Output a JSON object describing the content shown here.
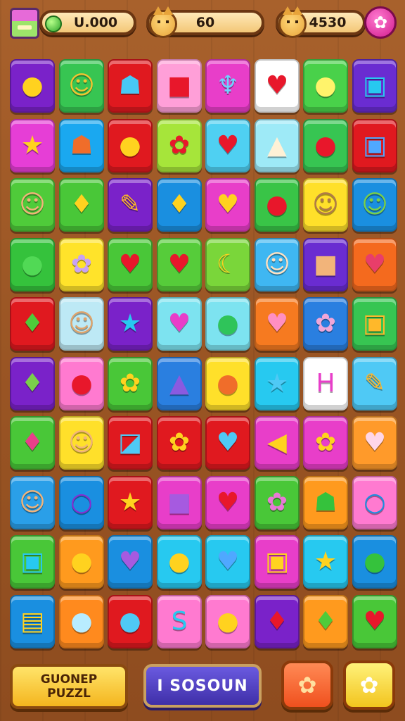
{
  "hud": {
    "coins": "U.000",
    "moves": "60",
    "score": "4530",
    "icons": {
      "shop": "gift-box-icon",
      "coin": "green-gem-icon",
      "moves": "cat-face-icon",
      "score": "cat-face-icon",
      "settings": "flower-icon"
    }
  },
  "board": {
    "rows": 10,
    "cols": 8,
    "tiles": [
      [
        {
          "c": "#7a22c9",
          "g": "●",
          "gc": "#ffd21f"
        },
        {
          "c": "#37c552",
          "g": "☺",
          "gc": "#f4c430"
        },
        {
          "c": "#e0191f",
          "g": "☗",
          "gc": "#47c8f5"
        },
        {
          "c": "#ff9fd8",
          "g": "■",
          "gc": "#e8172b"
        },
        {
          "c": "#e83ec9",
          "g": "♆",
          "gc": "#6fd3ff"
        },
        {
          "c": "#ffffff",
          "g": "♥",
          "gc": "#e8172b"
        },
        {
          "c": "#49d14a",
          "g": "●",
          "gc": "#fff36b"
        },
        {
          "c": "#6a2cd1",
          "g": "▣",
          "gc": "#27c9f0"
        }
      ],
      [
        {
          "c": "#e63ed6",
          "g": "★",
          "gc": "#ffd21f"
        },
        {
          "c": "#1aa8f0",
          "g": "☗",
          "gc": "#f06d2a"
        },
        {
          "c": "#e0191f",
          "g": "●",
          "gc": "#ffd21f"
        },
        {
          "c": "#a6e53a",
          "g": "✿",
          "gc": "#e8172b"
        },
        {
          "c": "#4fd0f2",
          "g": "♥",
          "gc": "#e8172b"
        },
        {
          "c": "#9eeaf7",
          "g": "▲",
          "gc": "#fff1d6"
        },
        {
          "c": "#37c552",
          "g": "●",
          "gc": "#e8172b"
        },
        {
          "c": "#e0191f",
          "g": "▣",
          "gc": "#4fa8ff"
        }
      ],
      [
        {
          "c": "#4fcb3a",
          "g": "☺",
          "gc": "#f2b47a"
        },
        {
          "c": "#49c738",
          "g": "♦",
          "gc": "#ffd21f"
        },
        {
          "c": "#7a22c9",
          "g": "✎",
          "gc": "#ffb82a"
        },
        {
          "c": "#1a8fe0",
          "g": "♦",
          "gc": "#ffd21f"
        },
        {
          "c": "#e83ec9",
          "g": "♥",
          "gc": "#ffd21f"
        },
        {
          "c": "#39c447",
          "g": "●",
          "gc": "#e8172b"
        },
        {
          "c": "#ffe02a",
          "g": "☺",
          "gc": "#b07a4a"
        },
        {
          "c": "#1a8fe0",
          "g": "☺",
          "gc": "#7ad04a"
        }
      ],
      [
        {
          "c": "#35c23c",
          "g": "●",
          "gc": "#51d955"
        },
        {
          "c": "#ffe32a",
          "g": "✿",
          "gc": "#c8a2f5"
        },
        {
          "c": "#49c738",
          "g": "♥",
          "gc": "#e8172b"
        },
        {
          "c": "#56cc3a",
          "g": "♥",
          "gc": "#e8172b"
        },
        {
          "c": "#7ad63a",
          "g": "☾",
          "gc": "#ffd21f"
        },
        {
          "c": "#3fb7f2",
          "g": "☺",
          "gc": "#ffe1c2"
        },
        {
          "c": "#6a2cd1",
          "g": "■",
          "gc": "#f2b47a"
        },
        {
          "c": "#f46a1e",
          "g": "♥",
          "gc": "#e83e6a"
        }
      ],
      [
        {
          "c": "#e0191f",
          "g": "♦",
          "gc": "#4fcb3a"
        },
        {
          "c": "#bde9f5",
          "g": "☺",
          "gc": "#e0a46a"
        },
        {
          "c": "#7a22c9",
          "g": "★",
          "gc": "#27c9f0"
        },
        {
          "c": "#7de3f0",
          "g": "♥",
          "gc": "#e83ec9"
        },
        {
          "c": "#7de3f0",
          "g": "●",
          "gc": "#2fc45a"
        },
        {
          "c": "#f67a20",
          "g": "♥",
          "gc": "#ff8fc2"
        },
        {
          "c": "#2a7fe0",
          "g": "✿",
          "gc": "#f0a6d8"
        },
        {
          "c": "#37c552",
          "g": "▣",
          "gc": "#ffb82a"
        }
      ],
      [
        {
          "c": "#7a22c9",
          "g": "♦",
          "gc": "#7ad04a"
        },
        {
          "c": "#ff7ad0",
          "g": "●",
          "gc": "#e8172b"
        },
        {
          "c": "#49c738",
          "g": "✿",
          "gc": "#ffd21f"
        },
        {
          "c": "#2a7fe0",
          "g": "▲",
          "gc": "#8a5ae0"
        },
        {
          "c": "#ffe02a",
          "g": "●",
          "gc": "#f06d2a"
        },
        {
          "c": "#27c9f0",
          "g": "★",
          "gc": "#4fc9f5"
        },
        {
          "c": "#ffffff",
          "g": "H",
          "gc": "#e83ec9"
        },
        {
          "c": "#4fc9f5",
          "g": "✎",
          "gc": "#ffb82a"
        }
      ],
      [
        {
          "c": "#49c738",
          "g": "♦",
          "gc": "#e83e8a"
        },
        {
          "c": "#ffe02a",
          "g": "☺",
          "gc": "#f2b47a"
        },
        {
          "c": "#e0191f",
          "g": "◪",
          "gc": "#4fc9f5"
        },
        {
          "c": "#e0191f",
          "g": "✿",
          "gc": "#ffd21f"
        },
        {
          "c": "#e0191f",
          "g": "♥",
          "gc": "#4fc9f5"
        },
        {
          "c": "#e83ec9",
          "g": "◀",
          "gc": "#ffd21f"
        },
        {
          "c": "#e83ec9",
          "g": "✿",
          "gc": "#ffd21f"
        },
        {
          "c": "#ff9a2a",
          "g": "♥",
          "gc": "#ffd6e8"
        }
      ],
      [
        {
          "c": "#2a9fe8",
          "g": "☺",
          "gc": "#f2b47a"
        },
        {
          "c": "#1a8fe0",
          "g": "○",
          "gc": "#8a2ad1"
        },
        {
          "c": "#e0191f",
          "g": "★",
          "gc": "#ffd21f"
        },
        {
          "c": "#e83ec9",
          "g": "■",
          "gc": "#a65ae0"
        },
        {
          "c": "#e83ec9",
          "g": "♥",
          "gc": "#e8172b"
        },
        {
          "c": "#49c738",
          "g": "✿",
          "gc": "#e87ad6"
        },
        {
          "c": "#ff9a1e",
          "g": "☗",
          "gc": "#35c23c"
        },
        {
          "c": "#ff7ad0",
          "g": "○",
          "gc": "#1a8fe0"
        }
      ],
      [
        {
          "c": "#49c738",
          "g": "▣",
          "gc": "#27c9f0"
        },
        {
          "c": "#ff9a1e",
          "g": "●",
          "gc": "#ffd21f"
        },
        {
          "c": "#1a8fe0",
          "g": "♥",
          "gc": "#a65ae0"
        },
        {
          "c": "#27c9f0",
          "g": "●",
          "gc": "#ffd21f"
        },
        {
          "c": "#27c9f0",
          "g": "♥",
          "gc": "#4fa8ff"
        },
        {
          "c": "#e83ec9",
          "g": "▣",
          "gc": "#ffd21f"
        },
        {
          "c": "#27c9f0",
          "g": "★",
          "gc": "#ffd21f"
        },
        {
          "c": "#1a8fe0",
          "g": "●",
          "gc": "#35c23c"
        }
      ],
      [
        {
          "c": "#1a8fe0",
          "g": "▤",
          "gc": "#ffd21f"
        },
        {
          "c": "#ff8a1e",
          "g": "●",
          "gc": "#b8ecff"
        },
        {
          "c": "#e0191f",
          "g": "●",
          "gc": "#4fc9f5"
        },
        {
          "c": "#ff7ad0",
          "g": "S",
          "gc": "#27c9f0"
        },
        {
          "c": "#ff7ad0",
          "g": "●",
          "gc": "#ffd21f"
        },
        {
          "c": "#7a22c9",
          "g": "♦",
          "gc": "#e8172b"
        },
        {
          "c": "#ff9a1e",
          "g": "♦",
          "gc": "#4fcb3a"
        },
        {
          "c": "#49c738",
          "g": "♥",
          "gc": "#e8172b"
        }
      ]
    ]
  },
  "footer": {
    "puzzle_line1": "GUONEP",
    "puzzle_line2": "PUZZL",
    "season_label": "I SOSOUN",
    "orange_icon": "flower-icon",
    "yellow_icon": "flower-icon"
  }
}
